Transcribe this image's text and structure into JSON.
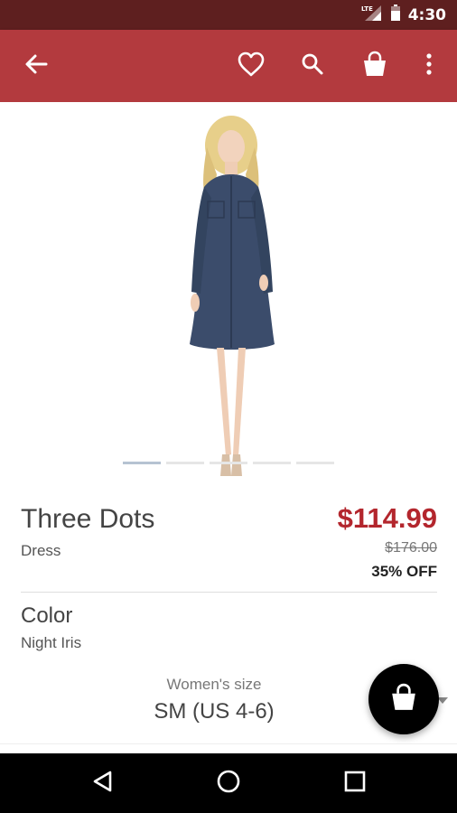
{
  "status_bar": {
    "network": "LTE",
    "time": "4:30"
  },
  "app_bar": {
    "icons": [
      "back-arrow-icon",
      "heart-icon",
      "search-icon",
      "shopping-bag-icon",
      "overflow-menu-icon"
    ],
    "color": "#b33a3e"
  },
  "gallery": {
    "page_count": 5,
    "active_index": 0
  },
  "product": {
    "brand": "Three Dots",
    "category": "Dress",
    "price": "$114.99",
    "original_price": "$176.00",
    "discount": "35% OFF"
  },
  "color": {
    "label": "Color",
    "value": "Night Iris"
  },
  "size": {
    "label": "Women's size",
    "value": "SM (US 4-6)"
  },
  "fab": {
    "icon": "shopping-bag-icon"
  },
  "nav_bar": {
    "icons": [
      "back-triangle-icon",
      "home-circle-icon",
      "recents-square-icon"
    ]
  },
  "colors": {
    "status_bar": "#5e1f1f",
    "app_bar": "#b33a3e",
    "price": "#b3262d"
  }
}
